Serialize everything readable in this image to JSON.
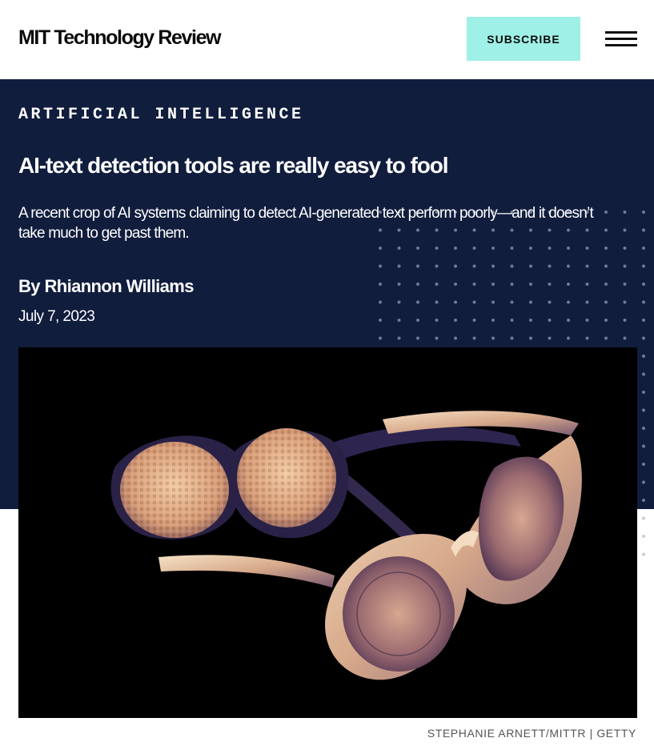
{
  "header": {
    "logo_text": "MIT Technology Review",
    "subscribe_label": "SUBSCRIBE",
    "menu_icon": "hamburger-menu-icon"
  },
  "article": {
    "category": "ARTIFICIAL INTELLIGENCE",
    "headline": "AI-text detection tools are really easy to fool",
    "dek": "A recent crop of AI systems claiming to detect AI-generated text perform poorly—and it doesn’t take much to get past them.",
    "byline_prefix": "By ",
    "author": "Rhiannon Williams",
    "date": "July 7, 2023"
  },
  "image": {
    "subject": "two-pairs-of-sunglasses",
    "credit": "STEPHANIE ARNETT/MITTR | GETTY"
  },
  "colors": {
    "hero_background": "#111d3d",
    "subscribe_background": "#9ff0e6",
    "dot_pattern": "#6f7a99",
    "credit_text": "#555555"
  }
}
